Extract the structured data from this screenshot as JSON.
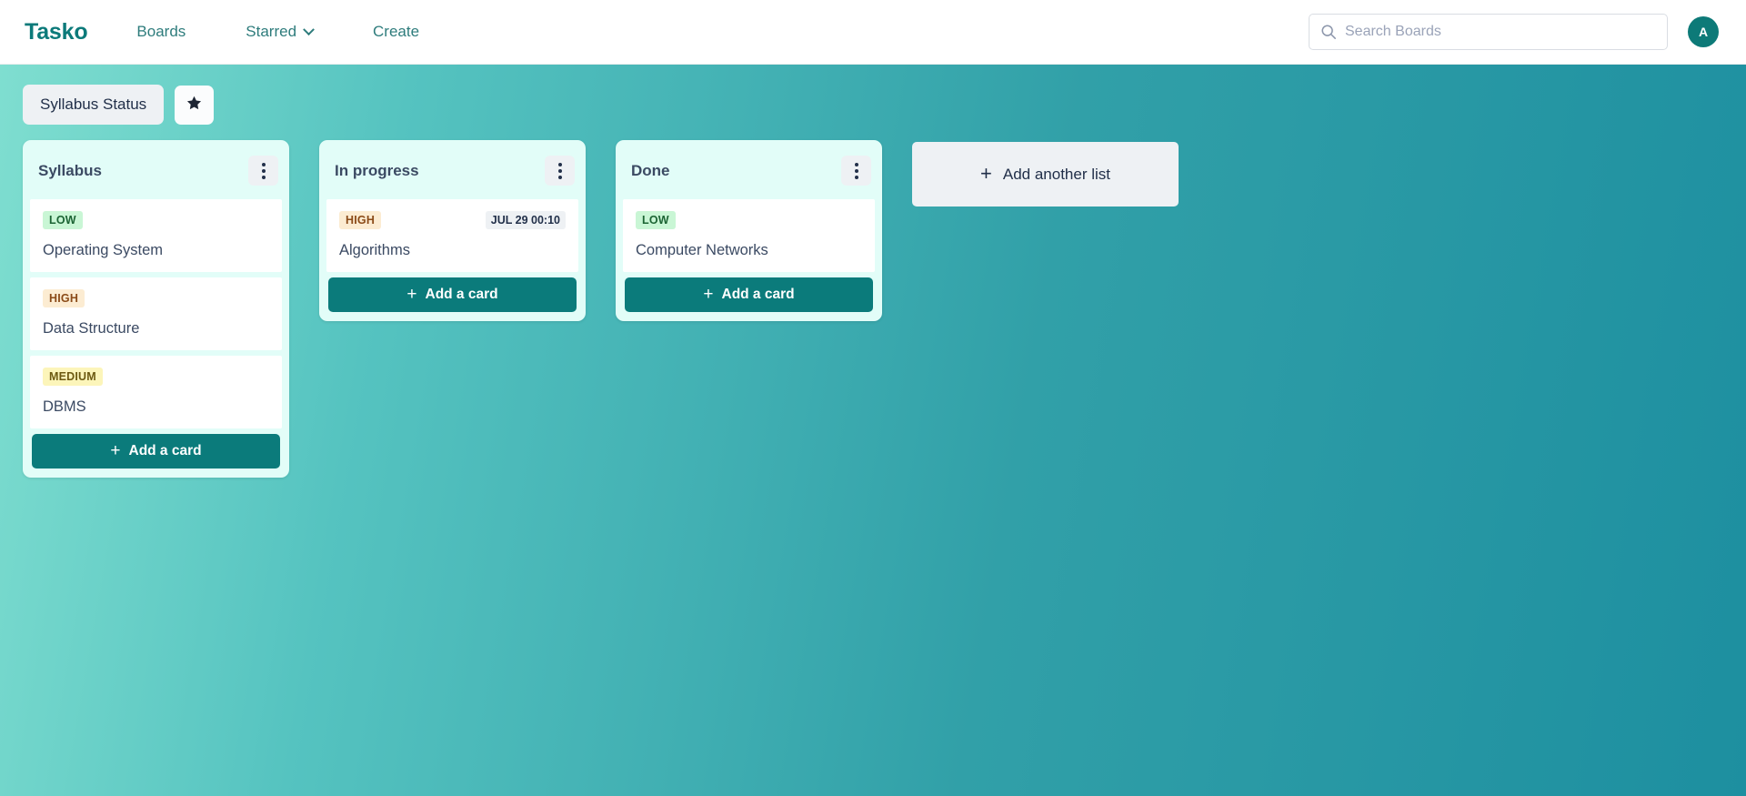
{
  "navbar": {
    "brand": "Tasko",
    "links": [
      {
        "label": "Boards",
        "icon": "none"
      },
      {
        "label": "Starred",
        "icon": "chevron-down-icon"
      },
      {
        "label": "Create",
        "icon": "none"
      }
    ],
    "search": {
      "placeholder": "Search Boards",
      "value": "",
      "icon": "search-icon"
    },
    "avatar": {
      "initial": "A",
      "color": "#0d7a78"
    }
  },
  "board": {
    "title": "Syllabus Status",
    "star_icon": "star-icon",
    "background_color": "#31a0a8",
    "add_list_label": "Add another list",
    "lists": [
      {
        "title": "Syllabus",
        "menu_icon": "kebab-menu-icon",
        "add_card_label": "Add a card",
        "cards": [
          {
            "priority": "LOW",
            "priority_class": "low",
            "title": "Operating System",
            "due": ""
          },
          {
            "priority": "HIGH",
            "priority_class": "high",
            "title": "Data Structure",
            "due": ""
          },
          {
            "priority": "MEDIUM",
            "priority_class": "medium",
            "title": "DBMS",
            "due": ""
          }
        ]
      },
      {
        "title": "In progress",
        "menu_icon": "kebab-menu-icon",
        "add_card_label": "Add a card",
        "cards": [
          {
            "priority": "HIGH",
            "priority_class": "high",
            "title": "Algorithms",
            "due": "JUL 29 00:10"
          }
        ]
      },
      {
        "title": "Done",
        "menu_icon": "kebab-menu-icon",
        "add_card_label": "Add a card",
        "cards": [
          {
            "priority": "LOW",
            "priority_class": "low",
            "title": "Computer Networks",
            "due": ""
          }
        ]
      }
    ]
  }
}
